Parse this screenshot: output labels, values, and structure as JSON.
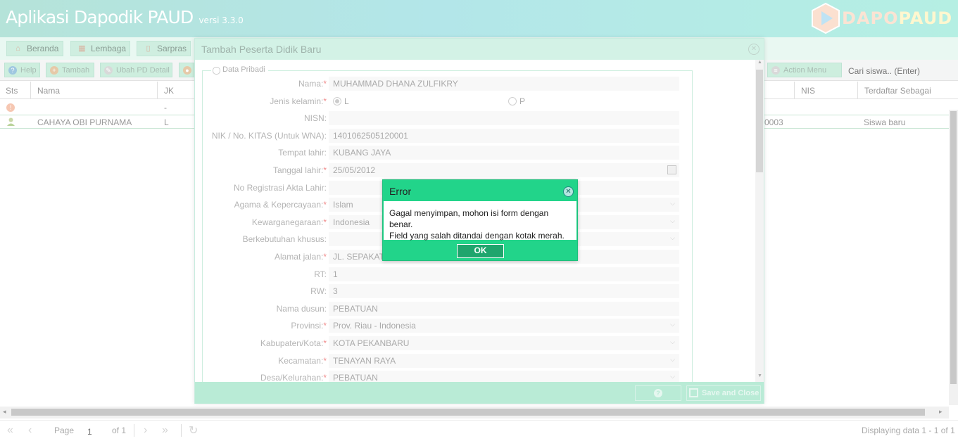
{
  "app": {
    "title": "Aplikasi Dapodik PAUD",
    "version": "versi 3.3.0",
    "logo_part1": "DAPO",
    "logo_part2": "PAUD"
  },
  "nav": [
    {
      "label": "Beranda",
      "icon": "home-icon"
    },
    {
      "label": "Lembaga",
      "icon": "building-icon"
    },
    {
      "label": "Sarpras",
      "icon": "clipboard-icon"
    }
  ],
  "toolbar": {
    "help": "Help",
    "tambah": "Tambah",
    "ubah": "Ubah PD Detail",
    "action_menu": "Action Menu",
    "search_placeholder": "Cari siswa.. (Enter)"
  },
  "grid": {
    "columns": {
      "sts": "Sts",
      "nama": "Nama",
      "jk": "JK",
      "nis": "NIS",
      "terdaftar": "Terdaftar Sebagai"
    },
    "rows": [
      {
        "nama": "",
        "jk": "-",
        "nis": "",
        "terdaftar": "",
        "status_icon": "warning-icon"
      },
      {
        "nama": "CAHAYA OBI PURNAMA",
        "jk": "L",
        "nis": "0003",
        "terdaftar": "Siswa baru",
        "status_icon": "user-icon"
      }
    ]
  },
  "pager": {
    "page_label": "Page",
    "page_value": "1",
    "of_label": "of 1",
    "display": "Displaying data 1 - 1 of 1"
  },
  "dialog": {
    "title": "Tambah Peserta Didik Baru",
    "section": "Data Pribadi",
    "fields": [
      {
        "label": "Nama:",
        "required": true,
        "value": "MUHAMMAD DHANA ZULFIKRY"
      },
      {
        "label": "Jenis kelamin:",
        "required": true,
        "value": ""
      },
      {
        "label": "NISN:",
        "required": false,
        "value": ""
      },
      {
        "label": "NIK / No. KITAS (Untuk WNA):",
        "required": false,
        "value": "1401062505120001"
      },
      {
        "label": "Tempat lahir:",
        "required": false,
        "value": "KUBANG JAYA"
      },
      {
        "label": "Tanggal lahir:",
        "required": true,
        "value": "25/05/2012"
      },
      {
        "label": "No Registrasi Akta Lahir:",
        "required": false,
        "value": ""
      },
      {
        "label": "Agama & Kepercayaan:",
        "required": true,
        "value": "Islam"
      },
      {
        "label": "Kewarganegaraan:",
        "required": true,
        "value": "Indonesia"
      },
      {
        "label": "Berkebutuhan khusus:",
        "required": false,
        "value": ""
      },
      {
        "label": "Alamat jalan:",
        "required": true,
        "value": "JL. SEPAKAT"
      },
      {
        "label": "RT:",
        "required": false,
        "value": "1"
      },
      {
        "label": "RW:",
        "required": false,
        "value": "3"
      },
      {
        "label": "Nama dusun:",
        "required": false,
        "value": "PEBATUAN"
      },
      {
        "label": "Provinsi:",
        "required": true,
        "value": "Prov. Riau - Indonesia"
      },
      {
        "label": "Kabupaten/Kota:",
        "required": true,
        "value": "KOTA PEKANBARU"
      },
      {
        "label": "Kecamatan:",
        "required": true,
        "value": "TENAYAN RAYA"
      },
      {
        "label": "Desa/Kelurahan:",
        "required": true,
        "value": "PEBATUAN"
      }
    ],
    "gender": {
      "l": "L",
      "p": "P",
      "selected": "L"
    },
    "save_label": "Save and Close"
  },
  "error_dialog": {
    "title": "Error",
    "line1": "Gagal menyimpan, mohon isi form dengan benar.",
    "line2": "Field yang salah ditandai dengan kotak merah.",
    "ok": "OK"
  }
}
